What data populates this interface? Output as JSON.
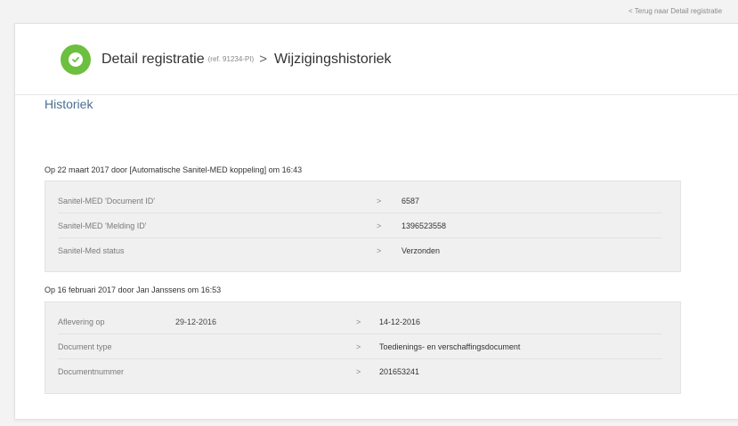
{
  "back_link": "< Terug naar Detail registratie",
  "header": {
    "title": "Detail registratie",
    "ref": "(ref. 91234-PI)",
    "separator": ">",
    "crumb": "Wijzigingshistoriek",
    "accent_color": "#6cbf3f"
  },
  "section_title": "Historiek",
  "entries": [
    {
      "title": "Op 22 maart 2017 door [Automatische Sanitel-MED koppeling] om 16:43",
      "rows": [
        {
          "label": "Sanitel-MED 'Document ID'",
          "arrow": ">",
          "value": "6587"
        },
        {
          "label": "Sanitel-MED 'Melding ID'",
          "arrow": ">",
          "value": "1396523558"
        },
        {
          "label": "Sanitel-Med status",
          "arrow": ">",
          "value": "Verzonden"
        }
      ]
    },
    {
      "title": "Op 16 februari 2017 door Jan Janssens om 16:53",
      "rows": [
        {
          "label": "Aflevering op",
          "old": "29-12-2016",
          "arrow": ">",
          "value": "14-12-2016"
        },
        {
          "label": "Document type",
          "arrow": ">",
          "value": "Toedienings- en verschaffingsdocument"
        },
        {
          "label": "Documentnummer",
          "arrow": ">",
          "value": "201653241"
        }
      ]
    }
  ]
}
